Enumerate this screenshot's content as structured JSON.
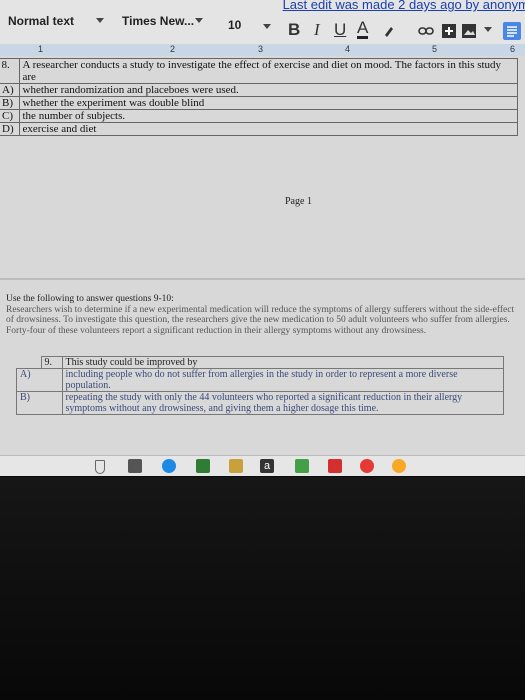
{
  "toolbar": {
    "last_edit": "Last edit was made 2 days ago by anonym",
    "style": "Normal text",
    "font": "Times New...",
    "size": "10",
    "bold": "B",
    "italic": "I",
    "underline": "U",
    "text_color": "A"
  },
  "ruler": [
    "1",
    "2",
    "3",
    "4",
    "5",
    "6"
  ],
  "q8": {
    "number": "8.",
    "stem": "A researcher conducts a study to investigate the effect of exercise and diet on mood. The factors in this study are",
    "options": [
      {
        "letter": "A)",
        "text": "whether randomization and placeboes were used."
      },
      {
        "letter": "B)",
        "text": "whether the experiment was double blind"
      },
      {
        "letter": "C)",
        "text": "the number of subjects."
      },
      {
        "letter": "D)",
        "text": "exercise and diet"
      }
    ]
  },
  "page_label": "Page 1",
  "passage": {
    "intro": "Use the following to answer questions 9-10:",
    "body": "Researchers wish to determine if a new experimental medication will reduce the symptoms of allergy sufferers without the side-effect of drowsiness. To investigate this question, the researchers give the new medication to 50 adult volunteers who suffer from allergies. Forty-four of these volunteers report a significant reduction in their allergy symptoms without any drowsiness."
  },
  "q9": {
    "number": "9.",
    "stem": "This study could be improved by",
    "options": [
      {
        "letter": "A)",
        "text": "including people who do not suffer from allergies in the study in order to represent a more diverse population."
      },
      {
        "letter": "B)",
        "text": "repeating the study with only the 44 volunteers who reported a significant reduction in their allergy symptoms without any drowsiness, and giving them a higher dosage this time."
      }
    ]
  },
  "taskbar": {
    "amazon_letter": "a"
  }
}
